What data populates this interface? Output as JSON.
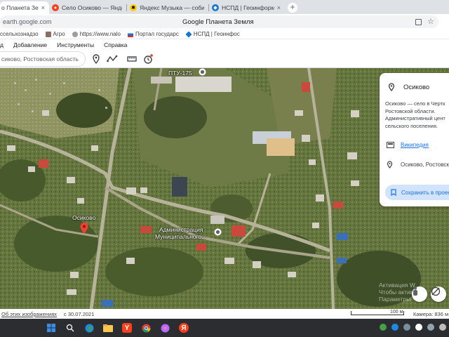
{
  "browser": {
    "tabs": [
      {
        "title": "о Планета Земля",
        "active": true,
        "favicon_color": "#1a73e8"
      },
      {
        "title": "Село Осиково — Яндекс",
        "active": false,
        "favicon_color": "#fc3f1d"
      },
      {
        "title": "Яндекс Музыка — собирае",
        "active": false,
        "favicon_color": "#ffcc00"
      },
      {
        "title": "НСПД | Геоинформацион",
        "active": false,
        "favicon_color": "#1976d2"
      }
    ],
    "new_tab_symbol": "+",
    "url": "earth.google.com",
    "page_title": "Google Планета Земля",
    "bookmarks": [
      {
        "label": "ссельхознадзо",
        "color": "#4caf50"
      },
      {
        "label": "Агро",
        "color": "#8d6e63"
      },
      {
        "label": "https://www.nalo",
        "color": "#9e9e9e"
      },
      {
        "label": "Портал государс",
        "color": "#d32f2f"
      },
      {
        "label": "НСПД | Геоинфос",
        "color": "#1976d2"
      }
    ]
  },
  "app_menu": [
    "д",
    "Добавление",
    "Инструменты",
    "Справка"
  ],
  "earth_toolbar": {
    "search_value": "сиково, Ростовская область",
    "buttons": [
      "place-pin",
      "path",
      "measure",
      "history"
    ]
  },
  "map": {
    "place_label": "Осиково",
    "building_label_top": "ПТУ-175",
    "admin_label_line1": "Администрация",
    "admin_label_line2": "Муниципального...",
    "watermark_line1": "Активация W",
    "watermark_line2": "Чтобы активиро",
    "watermark_line3": "Параметры"
  },
  "knowledge_card": {
    "title": "Осиково",
    "description_lines": [
      "Осиково — село в Чертк",
      "Ростовской области.",
      "Административный цент",
      "сельского поселения."
    ],
    "wiki_label": "Википедия",
    "location_text": "Осиково, Ростовск",
    "save_label": "Сохранить в проек"
  },
  "status_bar": {
    "source_link": "Об этих изображениях",
    "date": "с 30.07.2021",
    "scale_label": "100 м",
    "camera": "Камера: 836 м"
  },
  "taskbar": {
    "apps": [
      "windows-start",
      "search",
      "edge",
      "explorer",
      "yandex-browser",
      "chrome",
      "yandex-music",
      "yandex-app"
    ],
    "colors": {
      "accent": "#1a73e8",
      "taskbar_bg": "#2b2d31"
    }
  }
}
